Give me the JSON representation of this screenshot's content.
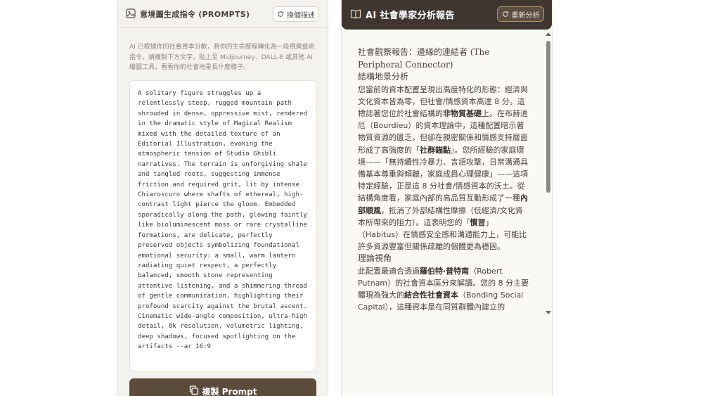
{
  "left_panel": {
    "title": "意境圖生成指令 (PROMPTS)",
    "icon": "image-icon",
    "swap_button": {
      "label": "換個描述",
      "icon": "refresh-icon"
    },
    "description": "AI 已根據你的社會資本分數，將你的生命歷程轉化為一段視覺藝術指令。請複製下方文字，貼上至 Midjourney、DALL-E 或其他 AI 繪圖工具，看看你的社會地景長什麼樣子。",
    "prompt_text": "A solitary figure struggles up a relentlessly steep, rugged mountain path shrouded in dense, oppressive mist, rendered in the dramatic style of Magical Realism mixed with the detailed texture of an Editorial Illustration, evoking the atmospheric tension of Studio Ghibli narratives. The terrain is unforgiving shale and tangled roots, suggesting immense friction and required grit, lit by intense Chiaroscuro where shafts of ethereal, high-contrast light pierce the gloom. Embedded sporadically along the path, glowing faintly like bioluminescent moss or rare crystalline formations, are delicate, perfectly preserved objects symbolizing foundational emotional security: a small, warm lantern radiating quiet respect, a perfectly balanced, smooth stone representing attentive listening, and a shimmering thread of gentle communication, highlighting their profound scarcity against the brutal ascent. Cinematic wide-angle composition, ultra-high detail, 8k resolution, volumetric lighting, deep shadows, focused spotlighting on the artifacts --ar 16:9",
    "copy_button": {
      "label": "複製 Prompt",
      "icon": "copy-icon"
    }
  },
  "right_panel": {
    "title": "AI 社會學家分析報告",
    "icon": "book-icon",
    "reanalyze_button": {
      "label": "重新分析",
      "icon": "refresh-icon"
    },
    "report": {
      "title": "社會觀察報告：邊緣的連結者 (The Peripheral Connector)",
      "section1_heading": "結構地景分析",
      "section1_body": [
        {
          "text": "您當前的資本配置呈現出高度特化的形態：經濟與文化資本皆為零，但社會/情感資本高達 8 分。這標誌著您位於社會結構的",
          "bold": false
        },
        {
          "text": "非物質基礎",
          "bold": true
        },
        {
          "text": "上。在布赫迪厄（Bourdieu）的資本理論中，這種配置暗示著物質資源的匱乏，但卻在親密關係和情感支持層面形成了高強度的「",
          "bold": false
        },
        {
          "text": "社群錨點",
          "bold": true
        },
        {
          "text": "」。您所經驗的家庭環境——「無持續性冷暴力、言語攻擊，日常溝通具備基本尊重與傾聽，家庭成員心理健康」——這項特定經驗，正是這 8 分社會/情感資本的沃土。從結構角度看，家庭內部的高品質互動形成了一種",
          "bold": false
        },
        {
          "text": "內部順風",
          "bold": true
        },
        {
          "text": "，抵消了外部結構性摩擦（低經濟/文化資本所帶來的阻力）。這表明您的「",
          "bold": false
        },
        {
          "text": "慣習",
          "bold": true
        },
        {
          "text": "」（Habitus）在情感安全感和溝通能力上，可能比許多資源豐富但關係疏離的個體更為穩固。",
          "bold": false
        }
      ],
      "section2_heading": "理論視角",
      "section2_body": [
        {
          "text": "此配置最適合透過",
          "bold": false
        },
        {
          "text": "羅伯特·普特南",
          "bold": true
        },
        {
          "text": "（Robert Putnam）的社會資本區分來解讀。您的 8 分主要體現為強大的",
          "bold": false
        },
        {
          "text": "結合性社會資本",
          "bold": true
        },
        {
          "text": "（Bonding Social Capital），這種資本是在同質群體內建立的",
          "bold": false
        }
      ]
    }
  }
}
